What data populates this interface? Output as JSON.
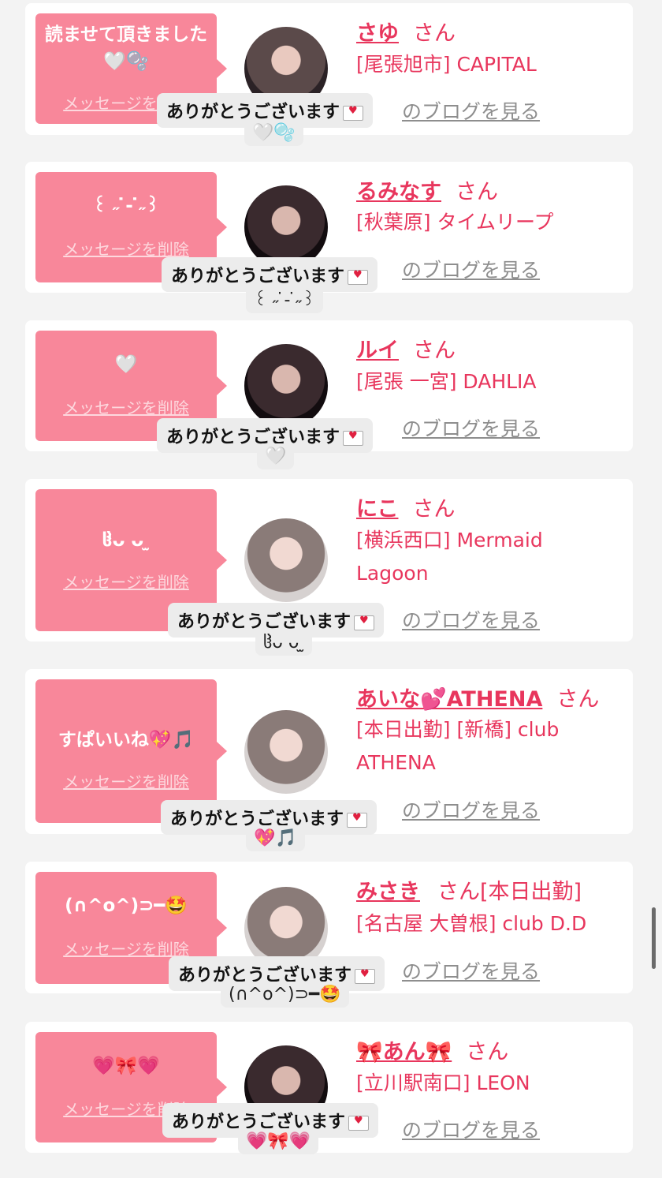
{
  "delete_label": "メッセージを削除",
  "blog_label": "のブログを見る",
  "honorific": "さん",
  "thanks_text": "ありがとうございます",
  "cards": [
    {
      "message": "読ませて頂きました🤍🫧",
      "name": "さゆ",
      "shop": "[尾張旭市] CAPITAL",
      "reply_emoji": "🤍🫧"
    },
    {
      "message": "꒰ ˶ ̇- ̇˶꒱",
      "name": "るみなす",
      "shop": "[秋葉原] タイムリープ",
      "reply_emoji": "꒰ ˶ ̇- ̇˶꒱"
    },
    {
      "message": "🤍",
      "name": "ルイ",
      "shop": "[尾張 一宮] DAHLIA",
      "reply_emoji": "🤍"
    },
    {
      "message": "ჱ̒ᴗ ᴗ ̫",
      "name": "にこ",
      "shop": "[横浜西口] Mermaid Lagoon",
      "reply_emoji": "ჱ̒ᴗ ᴗ ̫"
    },
    {
      "message": "すぱいいね💖🎵",
      "name": "あいな💕ATHENA",
      "shop": "[本日出勤] [新橋] club ATHENA",
      "reply_emoji": "💖🎵"
    },
    {
      "message": "(∩^o^)⊃━🤩",
      "name": "みさき",
      "shop_top": "[本日出勤]",
      "shop": "[名古屋 大曽根] club D.D",
      "reply_emoji": "(∩^o^)⊃━🤩"
    },
    {
      "message": "💗🎀💗",
      "name": "🎀あん🎀",
      "shop": "[立川駅南口] LEON",
      "reply_emoji": "💗🎀💗"
    }
  ]
}
